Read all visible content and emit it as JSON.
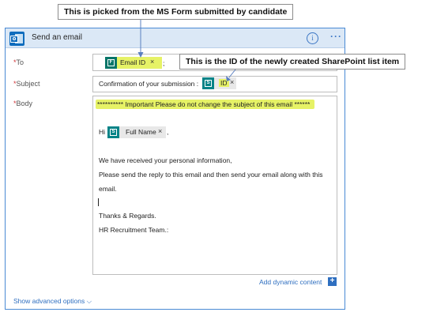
{
  "action": {
    "title": "Send an email",
    "info_glyph": "i",
    "more_glyph": "···"
  },
  "to": {
    "label": "To",
    "required_mark": "*",
    "token_label": "Email ID",
    "token_source_icon": "forms-icon",
    "token_remove": "×",
    "separator": ";"
  },
  "subject": {
    "label": "Subject",
    "required_mark": "*",
    "text": "Confirmation of your submission :",
    "token_label": "ID",
    "token_source_icon": "sharepoint-icon",
    "token_remove": "×"
  },
  "body": {
    "label": "Body",
    "required_mark": "*",
    "warning_line": "********** Important Please do not change the subject of this email  ******",
    "greeting": "Hi",
    "name_token_label": "Full Name",
    "name_token_source_icon": "sharepoint-icon",
    "name_token_remove": "×",
    "name_suffix": ",",
    "lines": [
      "We have received your personal information,",
      "Please send the reply to this email and then send your email along with this",
      "email."
    ],
    "closing": [
      "Thanks & Regards.",
      "HR Recruitment Team.:"
    ]
  },
  "dynamic_content": {
    "label": "Add dynamic content",
    "glyph": "+"
  },
  "advanced": {
    "label": "Show advanced options",
    "chevron": "⌵"
  },
  "annotations": {
    "form_source": "This is picked from the MS Form submitted by candidate",
    "sharepoint_id": "This is the ID of the newly created SharePoint list item"
  },
  "colors": {
    "accent": "#2f6fc0",
    "header_bg": "#dbe8f6",
    "required": "#d13438",
    "highlight": "#e6f266",
    "forms_token": "#077568",
    "sharepoint_token": "#038387"
  }
}
